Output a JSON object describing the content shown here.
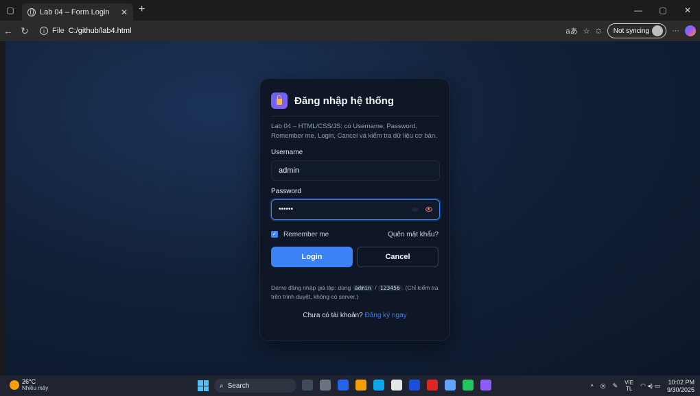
{
  "browser": {
    "tab_title": "Lab 04 – Form Login",
    "address_label": "File",
    "address_path": "C:/github/lab4.html",
    "sync_label": "Not syncing",
    "more_label": "···"
  },
  "login": {
    "title": "Đăng nhập hệ thống",
    "description": "Lab 04 – HTML/CSS/JS: có Username, Password, Remember me, Login, Cancel và kiểm tra dữ liệu cơ bản.",
    "username_label": "Username",
    "username_value": "admin",
    "password_label": "Password",
    "password_masked": "••••••",
    "remember_label": "Remember me",
    "remember_checked": true,
    "forgot_label": "Quên mật khẩu?",
    "login_button": "Login",
    "cancel_button": "Cancel",
    "demo_prefix": "Demo đăng nhập giả lập: dùng",
    "demo_user": "admin",
    "demo_sep": "/",
    "demo_pass": "123456",
    "demo_suffix": ". (Chỉ kiểm tra trên trình duyệt, không có server.)",
    "signup_prompt": "Chưa có tài khoản?",
    "signup_link": "Đăng ký ngay"
  },
  "taskbar": {
    "temperature": "26°C",
    "weather_text": "Nhiều mây",
    "search_label": "Search",
    "lang_top": "VIE",
    "lang_bottom": "TL",
    "time": "10:02 PM",
    "date": "9/30/2025"
  },
  "colors": {
    "accent": "#3b82f6",
    "card_bg": "#0f1726",
    "page_bg": "#122139"
  }
}
